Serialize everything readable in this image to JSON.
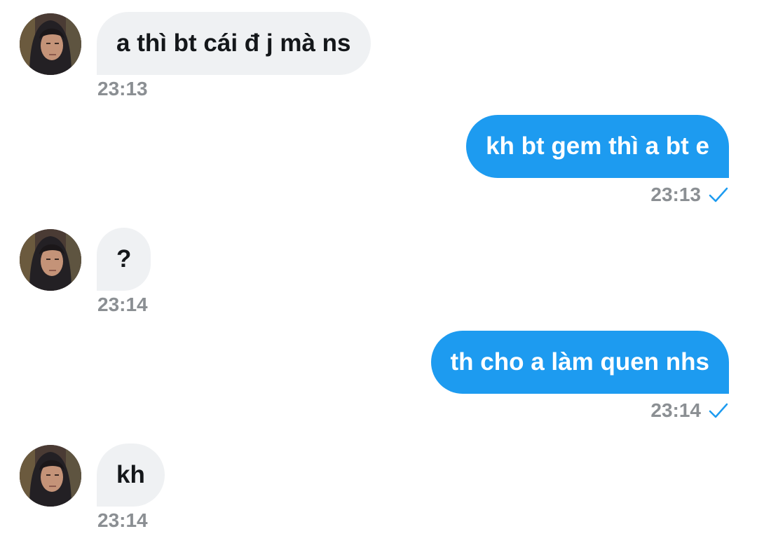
{
  "messages": [
    {
      "direction": "in",
      "text": "a thì bt cái đ j mà ns",
      "time": "23:13"
    },
    {
      "direction": "out",
      "text": "kh bt gem thì a bt e",
      "time": "23:13",
      "status_icon": "check-icon"
    },
    {
      "direction": "in",
      "text": "?",
      "time": "23:14"
    },
    {
      "direction": "out",
      "text": "th cho a làm quen nhs",
      "time": "23:14",
      "status_icon": "check-icon"
    },
    {
      "direction": "in",
      "text": "kh",
      "time": "23:14"
    }
  ],
  "colors": {
    "incoming_bubble": "#eff1f3",
    "outgoing_bubble": "#1d9bf0",
    "timestamp": "#8b8f93",
    "check": "#1d9bf0"
  }
}
